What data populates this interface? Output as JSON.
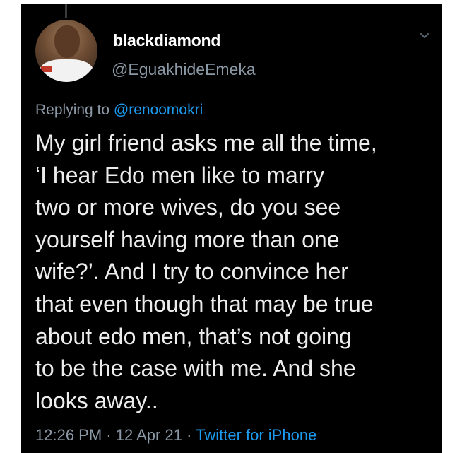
{
  "tweet": {
    "display_name": "blackdiamond",
    "handle": "@EguakhideEmeka",
    "reply_prefix": "Replying to ",
    "reply_mention": "@renoomokri",
    "text": "My girl friend asks me all the time,\n‘I hear Edo  men like to marry\ntwo or more wives, do you see\nyourself having more than one\nwife?’. And I try to convince her\nthat even though that may be true\nabout edo men, that’s not going\nto be the case with me. And she\nlooks away..",
    "time": "12:26 PM",
    "date": "12 Apr 21",
    "separator": "·",
    "source": "Twitter for iPhone"
  },
  "icons": {
    "more_menu": "chevron-down-icon",
    "avatar": "user-avatar"
  },
  "colors": {
    "background": "#000000",
    "link": "#1d9bf0",
    "secondary_text": "#8b98a5",
    "primary_text": "#ececec"
  }
}
